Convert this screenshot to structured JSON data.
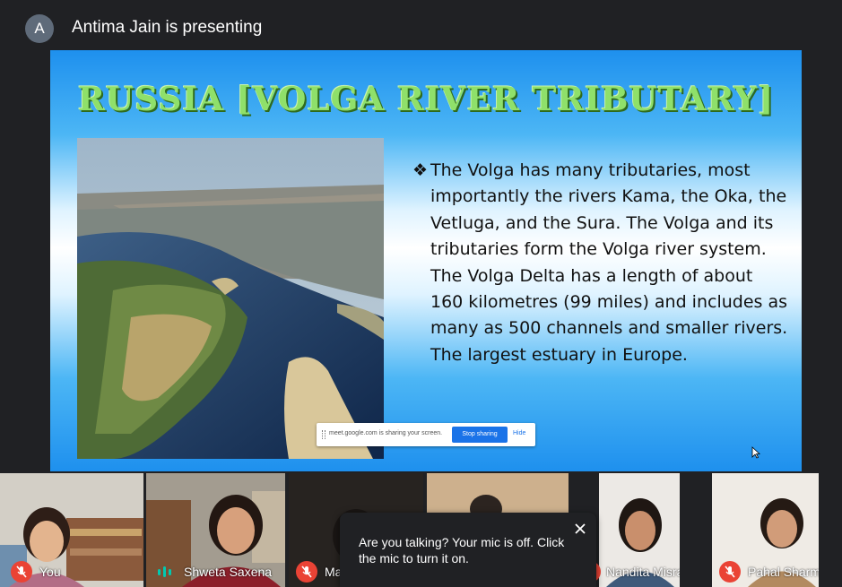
{
  "header": {
    "avatar_letter": "A",
    "presenting_text": "Antima Jain is presenting"
  },
  "slide": {
    "title": "RUSSIA [VOLGA RIVER TRIBUTARY]",
    "bullet_glyph": "❖",
    "bullet_text": "The Volga has many tributaries, most importantly the rivers Kama, the Oka, the Vetluga, and the Sura. The Volga and its tributaries form the Volga river system. The Volga Delta has a length of about 160 kilometres (99 miles) and includes as many as 500 channels and smaller rivers. The largest estuary in Europe."
  },
  "share_bar": {
    "message": "meet.google.com is sharing your screen.",
    "stop_label": "Stop sharing",
    "hide_label": "Hide"
  },
  "participants": [
    {
      "name": "You",
      "mic": "muted"
    },
    {
      "name": "Shweta Saxena",
      "mic": "speaking"
    },
    {
      "name": "Ma",
      "mic": "muted"
    },
    {
      "name": "",
      "mic": "none"
    },
    {
      "name": "Nandita Misra",
      "mic": "muted"
    },
    {
      "name": "Pahal Sharma",
      "mic": "muted"
    }
  ],
  "toast": {
    "message": "Are you talking? Your mic is off. Click the mic to turn it on."
  },
  "colors": {
    "meet_background": "#202124",
    "muted_red": "#ea4335",
    "speaking_teal": "#00c9b0",
    "title_green": "#8fe06a",
    "stop_blue": "#1a73e8"
  },
  "icons": [
    "mic-off-icon",
    "audio-wave-icon",
    "close-icon",
    "mouse-cursor-icon",
    "drag-handle-icon"
  ]
}
